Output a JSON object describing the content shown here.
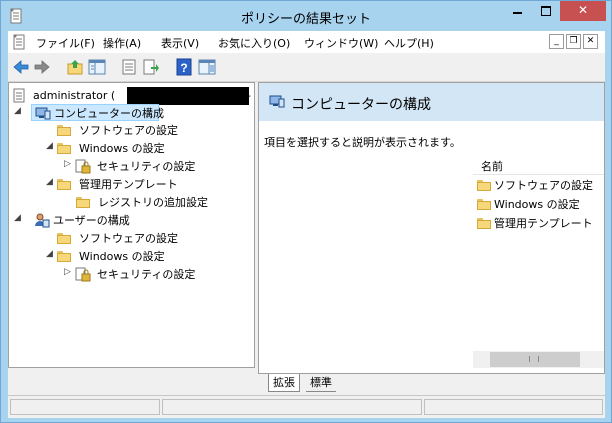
{
  "window": {
    "title": "ポリシーの結果セット",
    "close_glyph": "✕"
  },
  "menubar": {
    "items": [
      "ファイル(F)",
      "操作(A)",
      "表示(V)",
      "お気に入り(O)",
      "ウィンドウ(W)",
      "ヘルプ(H)"
    ],
    "mdi_min": "_",
    "mdi_restore": "❐",
    "mdi_close": "✕"
  },
  "toolbar": {
    "buttons": [
      "back-arrow-icon",
      "forward-arrow-icon",
      "up-folder-icon",
      "show-hide-tree-icon",
      "properties-icon",
      "export-list-icon",
      "help-icon",
      "show-action-pane-icon"
    ]
  },
  "tree": {
    "root_label": "administrator (",
    "root_suffix": "-",
    "computer_config": "コンピューターの構成",
    "software_settings": "ソフトウェアの設定",
    "windows_settings": "Windows の設定",
    "security_settings": "セキュリティの設定",
    "admin_templates": "管理用テンプレート",
    "extra_registry": "レジストリの追加設定",
    "user_config": "ユーザーの構成",
    "user_software_settings": "ソフトウェアの設定",
    "user_windows_settings": "Windows の設定",
    "user_security_settings": "セキュリティの設定",
    "expanded_glyph": "◢",
    "collapsed_glyph": "▷"
  },
  "scroll": {
    "left_arrow": "◀",
    "right_arrow": "▶"
  },
  "detail": {
    "header_title": "コンピューターの構成",
    "description": "項目を選択すると説明が表示されます。",
    "column_name": "名前",
    "items": [
      "ソフトウェアの設定",
      "Windows の設定",
      "管理用テンプレート"
    ]
  },
  "tabs": {
    "extended": "拡張",
    "standard": "標準"
  }
}
